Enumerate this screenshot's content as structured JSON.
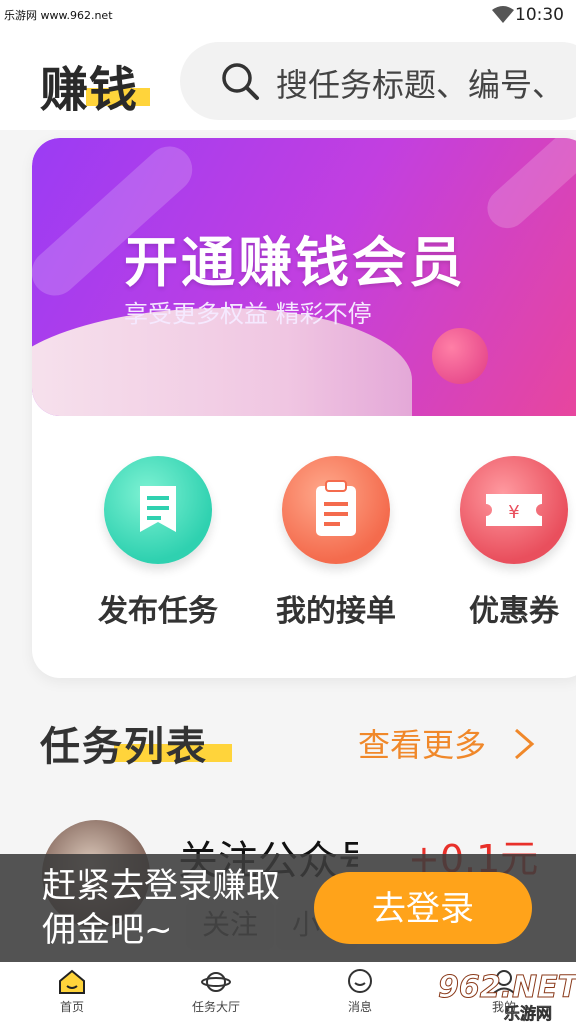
{
  "status_bar": {
    "watermark": "乐游网 www.962.net",
    "time": "10:30"
  },
  "header": {
    "brand": "赚钱",
    "search_placeholder": "搜任务标题、编号、"
  },
  "banner": {
    "title": "开通赚钱会员",
    "subtitle": "享受更多权益 精彩不停"
  },
  "quick_actions": [
    {
      "label": "发布任务",
      "icon": "document-list-icon",
      "color": "#2fd1b0"
    },
    {
      "label": "我的接单",
      "icon": "clipboard-icon",
      "color": "#f46b4d"
    },
    {
      "label": "优惠券",
      "icon": "coupon-icon",
      "color": "#e94f5d"
    }
  ],
  "task_section": {
    "title": "任务列表",
    "more": "查看更多"
  },
  "task": {
    "name": "关注公众号",
    "reward": "+0.1元",
    "tags": [
      "关注",
      "小"
    ]
  },
  "login_prompt": {
    "message": "赶紧去登录赚取佣金吧~",
    "button": "去登录"
  },
  "tabbar": {
    "items": [
      {
        "label": "首页",
        "icon": "home-icon"
      },
      {
        "label": "任务大厅",
        "icon": "planet-icon"
      },
      {
        "label": "消息",
        "icon": "message-icon"
      },
      {
        "label": "我的",
        "icon": "user-icon"
      }
    ]
  },
  "logo_watermark": {
    "big": "962.NET",
    "small": "乐游网"
  },
  "colors": {
    "accent": "#ffa31a",
    "highlight": "#ffd43b",
    "reward": "#e8302a",
    "more": "#f0882a"
  }
}
